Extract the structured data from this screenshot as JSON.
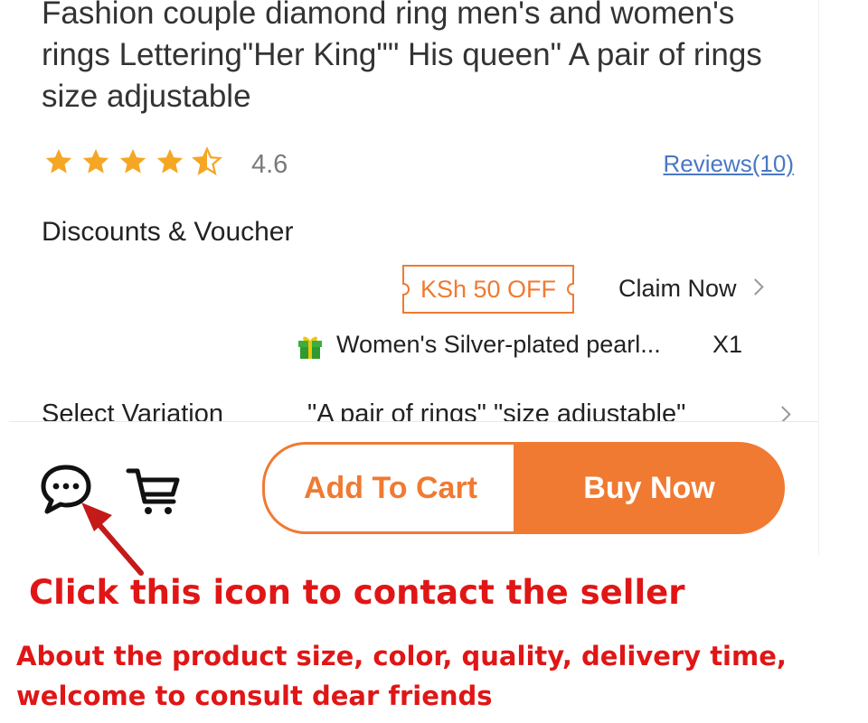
{
  "product": {
    "title": "Fashion couple diamond ring  men's and women's rings Lettering\"Her King\"\" His queen\" A pair of rings size adjustable",
    "rating": {
      "value_text": "4.6",
      "stars_filled": 4.6,
      "stars_max": 5,
      "star_color": "#f5a623",
      "reviews_label": "Reviews(10)"
    }
  },
  "discounts": {
    "label": "Discounts & Voucher",
    "voucher": {
      "badge_text": "KSh 50 OFF",
      "claim_label": "Claim Now"
    },
    "gift": {
      "icon": "gift-icon",
      "text": "Women's Silver-plated pearl...",
      "quantity": "X1"
    }
  },
  "variation": {
    "label": "Select Variation",
    "value": "\"A pair of rings\" \"size adjustable\""
  },
  "bottom_bar": {
    "chat_icon": "chat-bubble-icon",
    "cart_icon": "shopping-cart-icon",
    "add_to_cart_label": "Add To Cart",
    "buy_now_label": "Buy Now",
    "accent_color": "#f07a32"
  },
  "annotation": {
    "title": "Click this icon to contact the seller",
    "body_line1": "About the product size, color, quality, delivery time,",
    "body_line2": "welcome to consult dear friends",
    "color": "#e01616",
    "arrow_icon": "red-arrow-pointer"
  }
}
